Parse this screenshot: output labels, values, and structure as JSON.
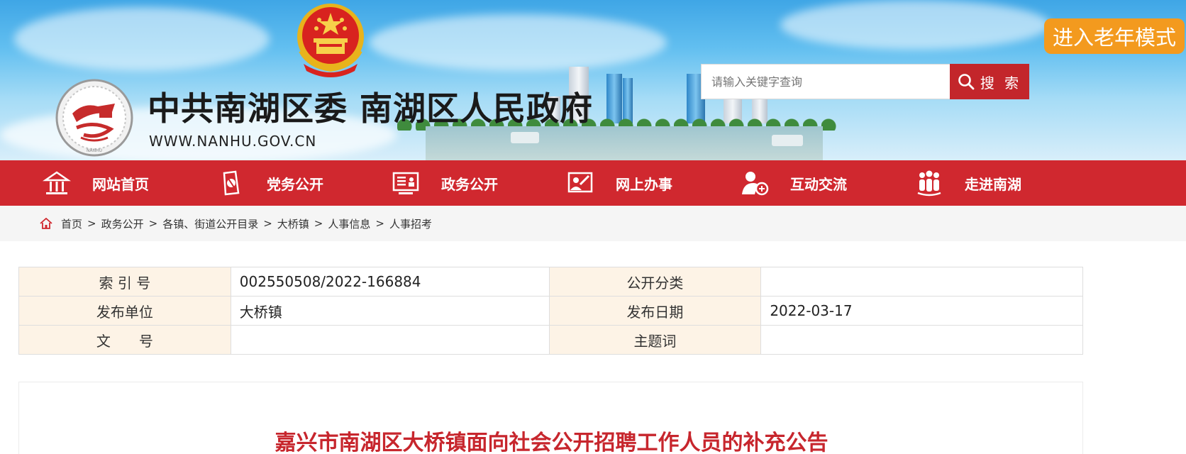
{
  "header": {
    "site_title": "中共南湖区委 南湖区人民政府",
    "site_domain": "WWW.NANHU.GOV.CN",
    "search_placeholder": "请输入关键字查询",
    "search_button": "搜 索",
    "elder_mode_button": "进入老年模式",
    "logo_caption": "NANHU"
  },
  "nav": {
    "items": [
      {
        "label": "网站首页",
        "icon": "home-icon"
      },
      {
        "label": "党务公开",
        "icon": "party-icon"
      },
      {
        "label": "政务公开",
        "icon": "government-affairs-icon"
      },
      {
        "label": "网上办事",
        "icon": "online-service-icon"
      },
      {
        "label": "互动交流",
        "icon": "interaction-icon"
      },
      {
        "label": "走进南湖",
        "icon": "people-icon"
      }
    ]
  },
  "breadcrumb": {
    "items": [
      "首页",
      "政务公开",
      "各镇、街道公开目录",
      "大桥镇",
      "人事信息",
      "人事招考"
    ],
    "separator": ">"
  },
  "meta": {
    "rows": [
      {
        "k1": "索 引 号",
        "v1": "002550508/2022-166884",
        "k2": "公开分类",
        "v2": ""
      },
      {
        "k1": "发布单位",
        "v1": "大桥镇",
        "k2": "发布日期",
        "v2": "2022-03-17"
      },
      {
        "k1": "文　　号",
        "v1": "",
        "k2": "主题词",
        "v2": ""
      }
    ]
  },
  "article": {
    "title": "嘉兴市南湖区大桥镇面向社会公开招聘工作人员的补充公告"
  },
  "colors": {
    "nav_red": "#d0282f",
    "search_red": "#c3262b",
    "elder_orange": "#f39a1e",
    "title_red": "#c7262d",
    "table_key_bg": "#fdf3e6"
  }
}
